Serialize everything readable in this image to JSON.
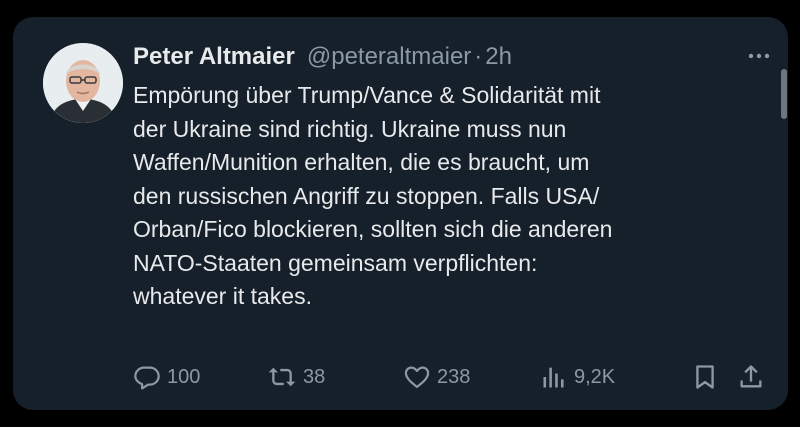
{
  "tweet": {
    "author_name": "Peter Altmaier",
    "handle": "@peteraltmaier",
    "separator": "·",
    "time": "2h",
    "text_lines": [
      "Empörung über Trump/Vance & Solidarität mit",
      "der Ukraine sind richtig. Ukraine muss nun",
      "Waffen/Munition erhalten, die es braucht, um",
      "den russischen Angriff zu stoppen. Falls USA/",
      "Orban/Fico blockieren, sollten sich die anderen",
      "NATO-Staaten gemeinsam verpflichten:",
      "whatever it takes."
    ]
  },
  "actions": {
    "replies": "100",
    "reposts": "38",
    "likes": "238",
    "views": "9,2K"
  },
  "icons": {
    "more": "more-horizontal-icon",
    "reply": "reply-icon",
    "repost": "repost-icon",
    "like": "heart-icon",
    "views": "analytics-icon",
    "bookmark": "bookmark-icon",
    "share": "share-icon"
  },
  "colors": {
    "background": "#15202b",
    "text": "#e7e9ea",
    "secondary": "#8b98a5"
  }
}
